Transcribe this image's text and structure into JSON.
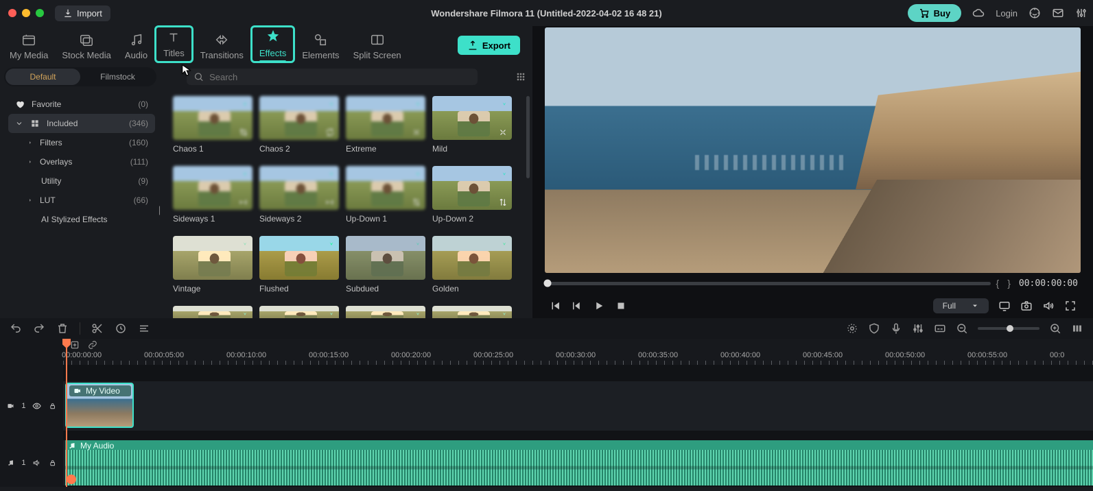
{
  "window": {
    "title": "Wondershare Filmora 11 (Untitled-2022-04-02 16 48 21)"
  },
  "topbar": {
    "import": "Import",
    "buy": "Buy",
    "login": "Login"
  },
  "tabs": {
    "my_media": "My Media",
    "stock_media": "Stock Media",
    "audio": "Audio",
    "titles": "Titles",
    "transitions": "Transitions",
    "effects": "Effects",
    "elements": "Elements",
    "split_screen": "Split Screen",
    "export": "Export"
  },
  "subtabs": {
    "default": "Default",
    "filmstock": "Filmstock"
  },
  "search": {
    "placeholder": "Search"
  },
  "sidebar": {
    "items": [
      {
        "label": "Favorite",
        "count": "(0)",
        "icon": "heart"
      },
      {
        "label": "Included",
        "count": "(346)",
        "icon": "grid",
        "active": true,
        "expanded": true
      },
      {
        "label": "Filters",
        "count": "(160)",
        "chev": true
      },
      {
        "label": "Overlays",
        "count": "(111)",
        "chev": true
      },
      {
        "label": "Utility",
        "count": "(9)"
      },
      {
        "label": "LUT",
        "count": "(66)",
        "chev": true
      },
      {
        "label": "AI Stylized Effects",
        "count": ""
      }
    ]
  },
  "effects": [
    {
      "label": "Chaos 1",
      "cls": "chaos1",
      "dl": true,
      "corner": "crop"
    },
    {
      "label": "Chaos 2",
      "cls": "chaos2",
      "dl": true,
      "corner": "spin"
    },
    {
      "label": "Extreme",
      "cls": "blur-strong",
      "dl": true,
      "corner": "zoom"
    },
    {
      "label": "Mild",
      "cls": "blur-mild",
      "dl": true,
      "corner": "zoom"
    },
    {
      "label": "Sideways 1",
      "cls": "side1",
      "dl": true,
      "corner": "eq"
    },
    {
      "label": "Sideways 2",
      "cls": "side2",
      "dl": true,
      "corner": "eq"
    },
    {
      "label": "Up-Down 1",
      "cls": "blur-strong",
      "dl": true,
      "corner": "updown"
    },
    {
      "label": "Up-Down 2",
      "cls": "blur-mild",
      "dl": true,
      "corner": "updown"
    },
    {
      "label": "Vintage",
      "cls": "vintage",
      "dl": true
    },
    {
      "label": "Flushed",
      "cls": "flushed",
      "dl": true
    },
    {
      "label": "Subdued",
      "cls": "subdued",
      "dl": true
    },
    {
      "label": "Golden",
      "cls": "golden",
      "dl": true
    }
  ],
  "preview": {
    "timecode": "00:00:00:00",
    "quality": "Full"
  },
  "timeline": {
    "marks": [
      "00:00:00:00",
      "00:00:05:00",
      "00:00:10:00",
      "00:00:15:00",
      "00:00:20:00",
      "00:00:25:00",
      "00:00:30:00",
      "00:00:35:00",
      "00:00:40:00",
      "00:00:45:00",
      "00:00:50:00",
      "00:00:55:00",
      "00:0"
    ],
    "video_track": {
      "index": "1",
      "clip_label": "My Video"
    },
    "audio_track": {
      "index": "1",
      "clip_label": "My Audio"
    }
  }
}
